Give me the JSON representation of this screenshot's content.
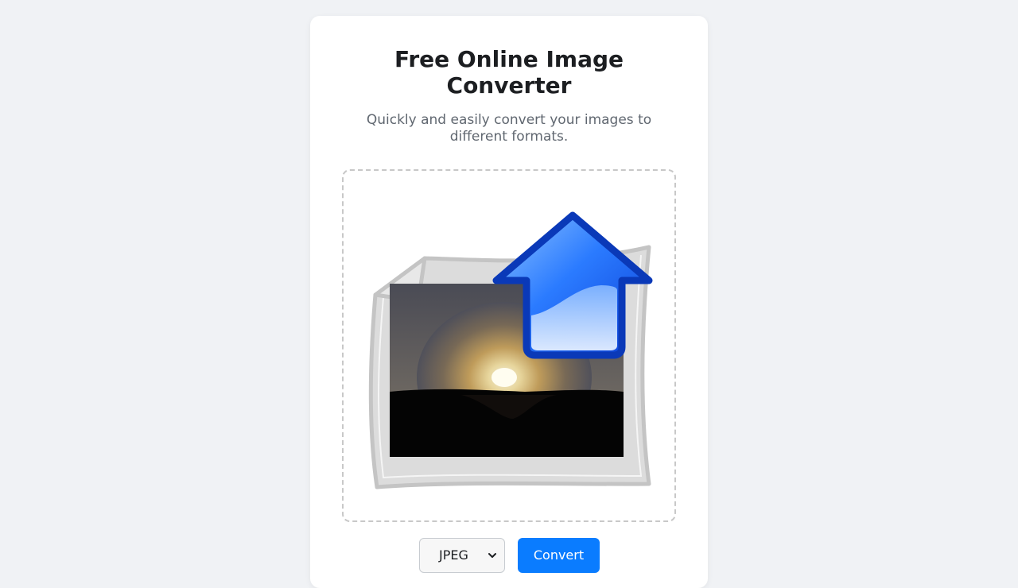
{
  "header": {
    "title": "Free Online Image Converter",
    "subtitle": "Quickly and easily convert your images to different formats."
  },
  "dropzone": {
    "icon": "upload-image-icon"
  },
  "controls": {
    "format_selected": "JPEG",
    "convert_label": "Convert"
  },
  "colors": {
    "background": "#f0f2f5",
    "card": "#ffffff",
    "accent": "#0a7cff",
    "arrow_blue": "#1a5cf0",
    "dropzone_border": "#c8c8c8"
  }
}
